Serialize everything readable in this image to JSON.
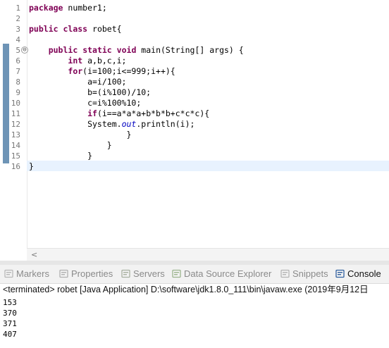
{
  "editor": {
    "line_numbers": [
      "1",
      "2",
      "3",
      "4",
      "5",
      "6",
      "7",
      "8",
      "9",
      "10",
      "11",
      "12",
      "13",
      "14",
      "15",
      "16"
    ],
    "fold_marker": "⊖",
    "lines": [
      [
        {
          "t": "package",
          "k": "kw"
        },
        {
          "t": " number1;",
          "k": ""
        }
      ],
      [],
      [
        {
          "t": "public",
          "k": "kw"
        },
        {
          "t": " ",
          "k": ""
        },
        {
          "t": "class",
          "k": "kw"
        },
        {
          "t": " robet{",
          "k": ""
        }
      ],
      [],
      [
        {
          "t": "    ",
          "k": ""
        },
        {
          "t": "public",
          "k": "kw"
        },
        {
          "t": " ",
          "k": ""
        },
        {
          "t": "static",
          "k": "kw"
        },
        {
          "t": " ",
          "k": ""
        },
        {
          "t": "void",
          "k": "kw"
        },
        {
          "t": " main(String[] args) {",
          "k": ""
        }
      ],
      [
        {
          "t": "        ",
          "k": ""
        },
        {
          "t": "int",
          "k": "kw"
        },
        {
          "t": " a,b,c,i;",
          "k": ""
        }
      ],
      [
        {
          "t": "        ",
          "k": ""
        },
        {
          "t": "for",
          "k": "kw"
        },
        {
          "t": "(i=100;i<=999;i++){",
          "k": ""
        }
      ],
      [
        {
          "t": "            a=i/100;",
          "k": ""
        }
      ],
      [
        {
          "t": "            b=(i%100)/10;",
          "k": ""
        }
      ],
      [
        {
          "t": "            c=i%100%10;",
          "k": ""
        }
      ],
      [
        {
          "t": "            ",
          "k": ""
        },
        {
          "t": "if",
          "k": "kw"
        },
        {
          "t": "(i==a*a*a+b*b*b+c*c*c){",
          "k": ""
        }
      ],
      [
        {
          "t": "            System.",
          "k": ""
        },
        {
          "t": "out",
          "k": "st"
        },
        {
          "t": ".println(i);",
          "k": ""
        }
      ],
      [
        {
          "t": "                    }",
          "k": ""
        }
      ],
      [
        {
          "t": "                }",
          "k": ""
        }
      ],
      [
        {
          "t": "            }",
          "k": ""
        }
      ],
      [
        {
          "t": "}",
          "k": ""
        }
      ]
    ],
    "scroll_left_arrow": "<"
  },
  "tabs": [
    {
      "label": "Markers",
      "icon": "markers-icon",
      "active": false
    },
    {
      "label": "Properties",
      "icon": "properties-icon",
      "active": false
    },
    {
      "label": "Servers",
      "icon": "servers-icon",
      "active": false
    },
    {
      "label": "Data Source Explorer",
      "icon": "data-source-explorer-icon",
      "active": false
    },
    {
      "label": "Snippets",
      "icon": "snippets-icon",
      "active": false
    },
    {
      "label": "Console",
      "icon": "console-icon",
      "active": true
    }
  ],
  "console": {
    "status": "<terminated> robet [Java Application] D:\\software\\jdk1.8.0_111\\bin\\javaw.exe (2019年9月12日",
    "output": [
      "153",
      "370",
      "371",
      "407"
    ]
  },
  "colors": {
    "keyword": "#7f0055",
    "static_field": "#0000c0",
    "current_line": "#e8f2fe",
    "change_bar": "#6e94b6"
  }
}
